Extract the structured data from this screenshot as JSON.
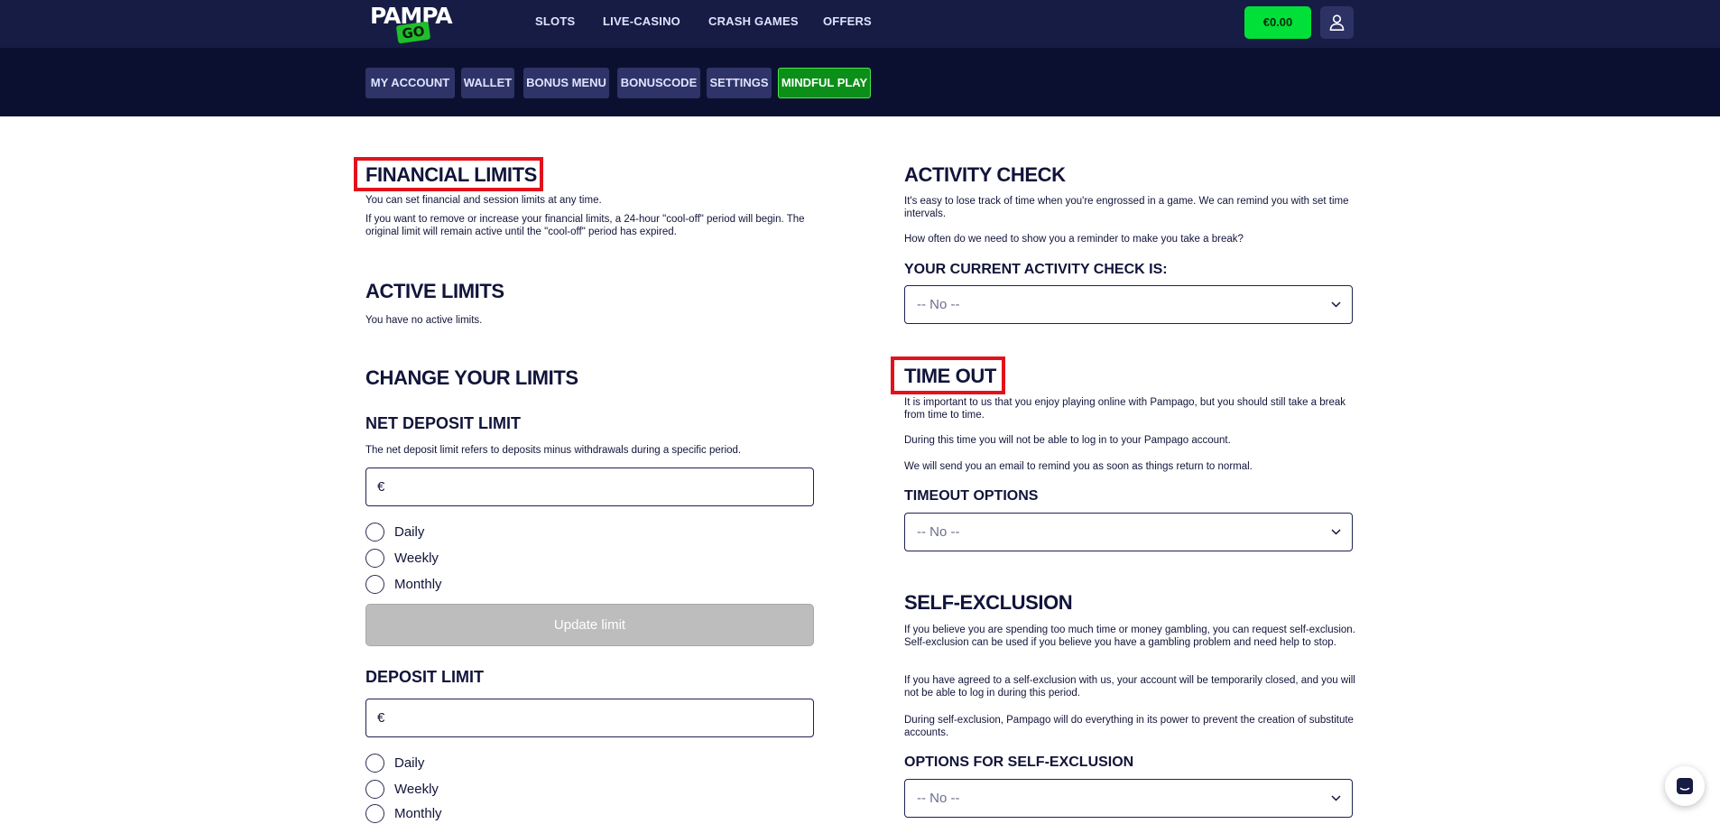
{
  "brand": {
    "logo_top": "PAMPA",
    "logo_bottom": "GO"
  },
  "topnav": {
    "items": [
      "SLOTS",
      "LIVE-CASINO",
      "CRASH GAMES",
      "OFFERS"
    ],
    "balance": "€0.00"
  },
  "account_tabs": [
    "MY ACCOUNT",
    "WALLET",
    "BONUS MENU",
    "BONUSCODE",
    "SETTINGS",
    "MINDFUL PLAY"
  ],
  "financial": {
    "title": "FINANCIAL LIMITS",
    "p1": "You can set financial and session limits at any time.",
    "p2": "If you want to remove or increase your financial limits, a 24-hour \"cool-off\" period will begin. The original limit will remain active until the \"cool-off\" period has expired."
  },
  "active_limits": {
    "title": "ACTIVE LIMITS",
    "text": "You have no active limits."
  },
  "change_limits": {
    "title": "CHANGE YOUR LIMITS",
    "net_deposit": {
      "title": "NET DEPOSIT LIMIT",
      "text": "The net deposit limit refers to deposits minus withdrawals during a specific period.",
      "currency": "€",
      "value": ""
    },
    "periods": [
      "Daily",
      "Weekly",
      "Monthly"
    ],
    "update_button": "Update limit",
    "deposit": {
      "title": "DEPOSIT LIMIT",
      "currency": "€",
      "value": ""
    }
  },
  "activity_check": {
    "title": "ACTIVITY CHECK",
    "p1": "It's easy to lose track of time when you're engrossed in a game. We can remind you with set time intervals.",
    "p2": "How often do we need to show you a reminder to make you take a break?",
    "label": "YOUR CURRENT ACTIVITY CHECK IS:",
    "selected": "-- No --"
  },
  "time_out": {
    "title": "TIME OUT",
    "p1": "It is important to us that you enjoy playing online with Pampago, but you should still take a break from time to time.",
    "p2": "During this time you will not be able to log in to your Pampago account.",
    "p3": "We will send you an email to remind you as soon as things return to normal.",
    "label": "TIMEOUT OPTIONS",
    "selected": "-- No --"
  },
  "self_exclusion": {
    "title": "SELF-EXCLUSION",
    "p1": "If you believe you are spending too much time or money gambling, you can request self-exclusion. Self-exclusion can be used if you believe you have a gambling problem and need help to stop.",
    "p2": "If you have agreed to a self-exclusion with us, your account will be temporarily closed, and you will not be able to log in during this period.",
    "p3": "During self-exclusion, Pampago will do everything in its power to prevent the creation of substitute accounts.",
    "label": "OPTIONS FOR SELF-EXCLUSION",
    "selected": "-- No --"
  },
  "colors": {
    "nav_bg": "#171c45",
    "subnav_bg": "#0c1030",
    "accent_green": "#00e038",
    "highlight_red": "#e2121c",
    "tab_bg": "#2e3467"
  },
  "icons": {
    "user": "user-icon",
    "chevron": "chevron-down-icon",
    "chat": "chat-icon"
  }
}
